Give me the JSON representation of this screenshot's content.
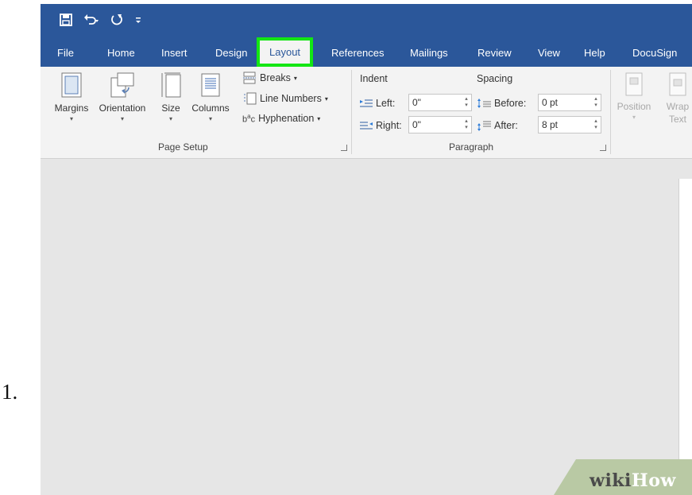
{
  "list_marker": "1.",
  "quick_access": {
    "save_icon": "save-icon",
    "undo_icon": "undo-icon",
    "redo_icon": "redo-icon",
    "customize_icon": "customize-qat-icon"
  },
  "tabs": [
    {
      "label": "File"
    },
    {
      "label": "Home"
    },
    {
      "label": "Insert"
    },
    {
      "label": "Design"
    },
    {
      "label": "Layout",
      "active": true,
      "highlight_color": "#13e613"
    },
    {
      "label": "References"
    },
    {
      "label": "Mailings"
    },
    {
      "label": "Review"
    },
    {
      "label": "View"
    },
    {
      "label": "Help"
    },
    {
      "label": "DocuSign"
    }
  ],
  "page_setup": {
    "margins": "Margins",
    "orientation": "Orientation",
    "size": "Size",
    "columns": "Columns",
    "breaks": "Breaks",
    "line_numbers": "Line Numbers",
    "hyphenation": "Hyphenation",
    "group_label": "Page Setup"
  },
  "paragraph": {
    "indent_title": "Indent",
    "spacing_title": "Spacing",
    "left_label": "Left:",
    "left_value": "0\"",
    "right_label": "Right:",
    "right_value": "0\"",
    "before_label": "Before:",
    "before_value": "0 pt",
    "after_label": "After:",
    "after_value": "8 pt",
    "group_label": "Paragraph"
  },
  "arrange": {
    "position": "Position",
    "wrap_text_line1": "Wrap",
    "wrap_text_line2": "Text"
  },
  "watermark": {
    "part1": "wiki",
    "part2": "How"
  },
  "colors": {
    "title_bar": "#2b579a",
    "ribbon": "#f3f3f3",
    "doc_background": "#e6e6e6",
    "highlight": "#13e613"
  }
}
